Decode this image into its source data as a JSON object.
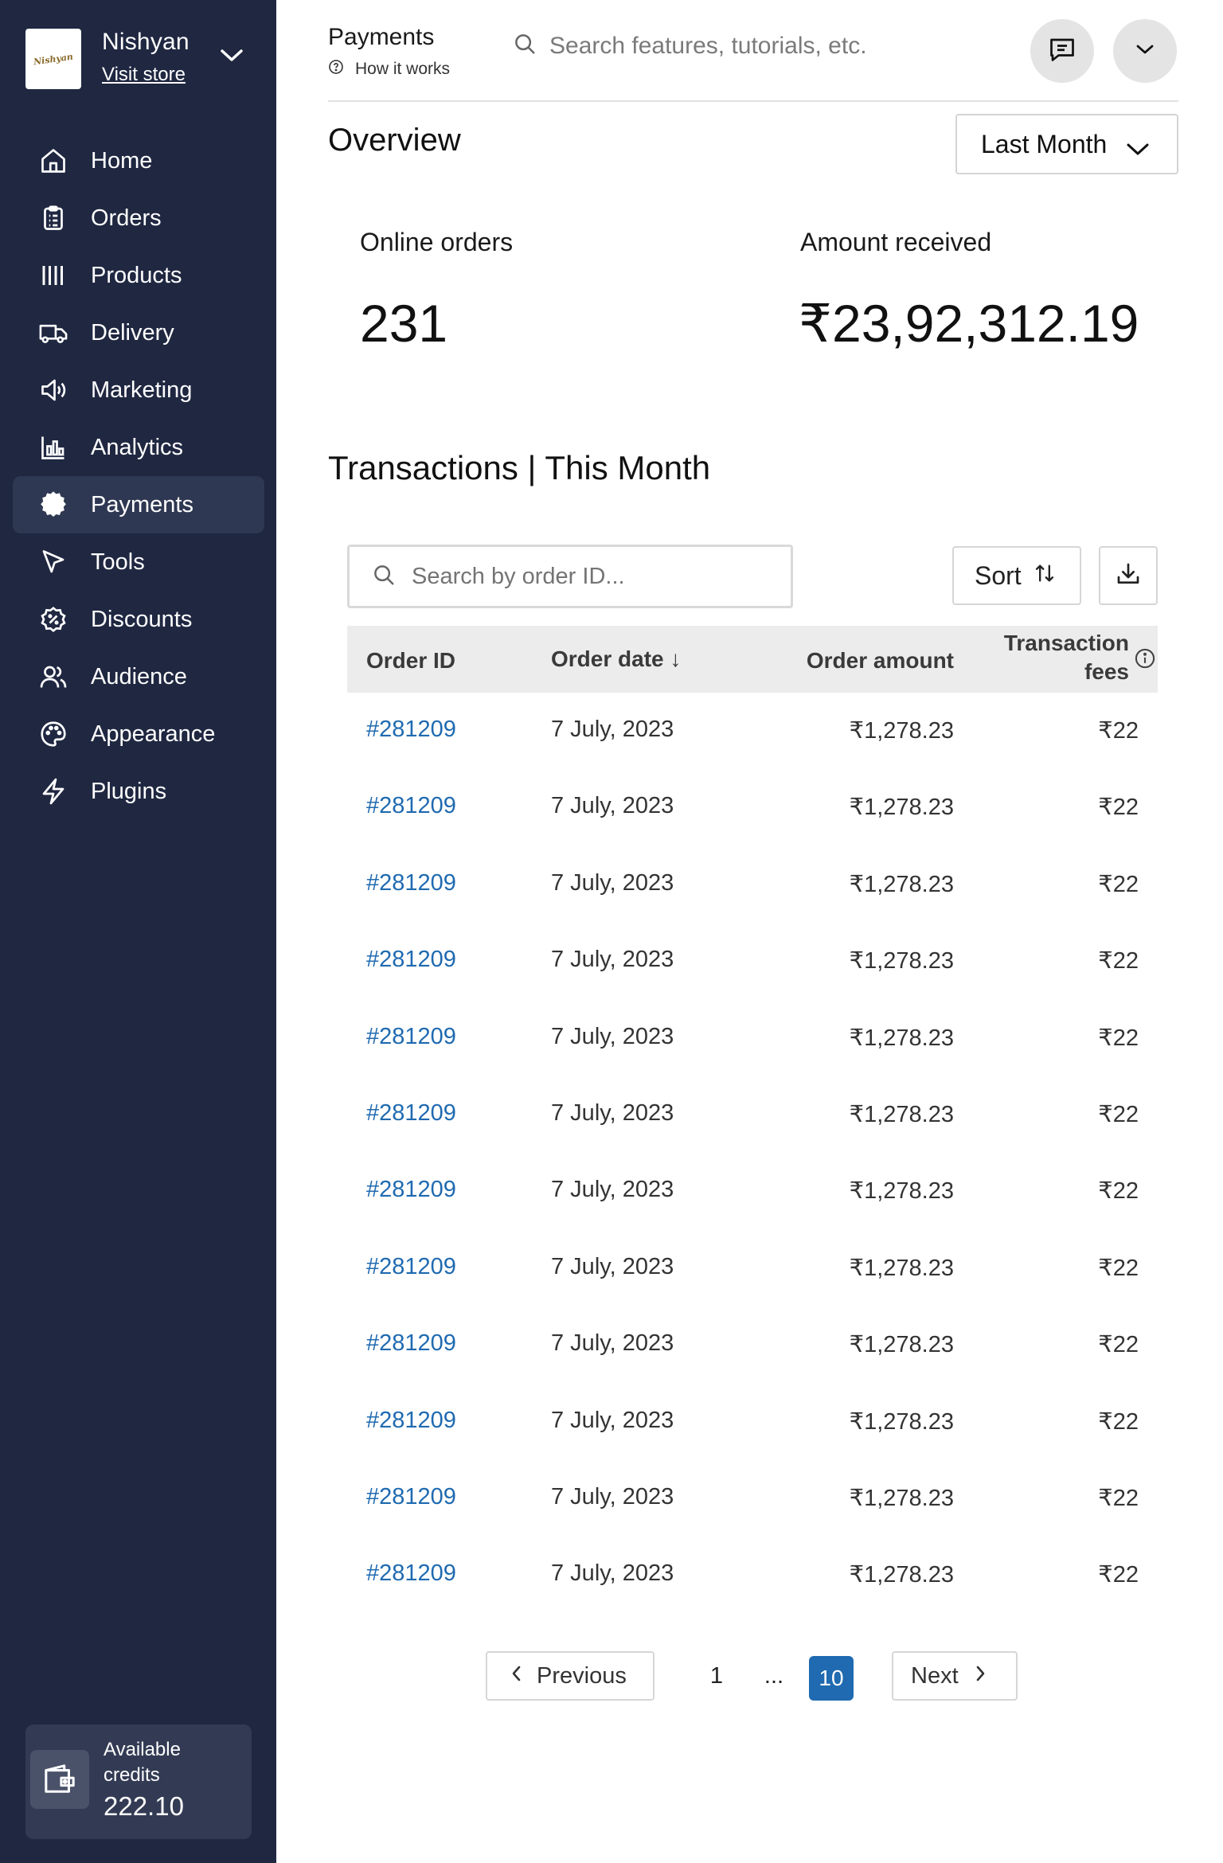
{
  "sidebar": {
    "store": {
      "name": "Nishyan",
      "visit_label": "Visit store",
      "logo_text": "Nishyan"
    },
    "items": [
      {
        "label": "Home",
        "icon": "home-icon"
      },
      {
        "label": "Orders",
        "icon": "orders-icon"
      },
      {
        "label": "Products",
        "icon": "products-icon"
      },
      {
        "label": "Delivery",
        "icon": "truck-icon"
      },
      {
        "label": "Marketing",
        "icon": "megaphone-icon"
      },
      {
        "label": "Analytics",
        "icon": "bar-chart-icon"
      },
      {
        "label": "Payments",
        "icon": "payments-icon",
        "active": true
      },
      {
        "label": "Tools",
        "icon": "cursor-icon"
      },
      {
        "label": "Discounts",
        "icon": "discount-icon"
      },
      {
        "label": "Audience",
        "icon": "users-icon"
      },
      {
        "label": "Appearance",
        "icon": "palette-icon"
      },
      {
        "label": "Plugins",
        "icon": "bolt-icon"
      }
    ],
    "credits": {
      "label": "Available credits",
      "value": "222.10",
      "icon": "wallet-icon"
    }
  },
  "header": {
    "title": "Payments",
    "help_label": "How it works",
    "search_placeholder": "Search features, tutorials, etc.",
    "icons": [
      "search-icon",
      "chat-icon",
      "chevron-down-icon"
    ]
  },
  "overview": {
    "title": "Overview",
    "period": "Last Month",
    "stats": [
      {
        "label": "Online orders",
        "value": "231"
      },
      {
        "label": "Amount received",
        "value": "₹23,92,312.19"
      }
    ]
  },
  "transactions": {
    "title": "Transactions | This Month",
    "search_placeholder": "Search by order ID...",
    "sort_label": "Sort",
    "columns": {
      "order_id": "Order ID",
      "order_date": "Order date ↓",
      "order_amount": "Order amount",
      "fees_line1": "Transaction",
      "fees_line2": "fees"
    },
    "rows": [
      {
        "id": "#281209",
        "date": "7 July, 2023",
        "amount": "₹1,278.23",
        "fee": "₹22"
      },
      {
        "id": "#281209",
        "date": "7 July, 2023",
        "amount": "₹1,278.23",
        "fee": "₹22"
      },
      {
        "id": "#281209",
        "date": "7 July, 2023",
        "amount": "₹1,278.23",
        "fee": "₹22"
      },
      {
        "id": "#281209",
        "date": "7 July, 2023",
        "amount": "₹1,278.23",
        "fee": "₹22"
      },
      {
        "id": "#281209",
        "date": "7 July, 2023",
        "amount": "₹1,278.23",
        "fee": "₹22"
      },
      {
        "id": "#281209",
        "date": "7 July, 2023",
        "amount": "₹1,278.23",
        "fee": "₹22"
      },
      {
        "id": "#281209",
        "date": "7 July, 2023",
        "amount": "₹1,278.23",
        "fee": "₹22"
      },
      {
        "id": "#281209",
        "date": "7 July, 2023",
        "amount": "₹1,278.23",
        "fee": "₹22"
      },
      {
        "id": "#281209",
        "date": "7 July, 2023",
        "amount": "₹1,278.23",
        "fee": "₹22"
      },
      {
        "id": "#281209",
        "date": "7 July, 2023",
        "amount": "₹1,278.23",
        "fee": "₹22"
      },
      {
        "id": "#281209",
        "date": "7 July, 2023",
        "amount": "₹1,278.23",
        "fee": "₹22"
      },
      {
        "id": "#281209",
        "date": "7 July, 2023",
        "amount": "₹1,278.23",
        "fee": "₹22"
      }
    ],
    "pagination": {
      "previous": "Previous",
      "first": "1",
      "ellipsis": "...",
      "current": "10",
      "next": "Next"
    }
  },
  "colors": {
    "sidebar_bg": "#1f2741",
    "active_item": "#2f3852",
    "link": "#1f6ab0",
    "table_header": "#ececec"
  }
}
